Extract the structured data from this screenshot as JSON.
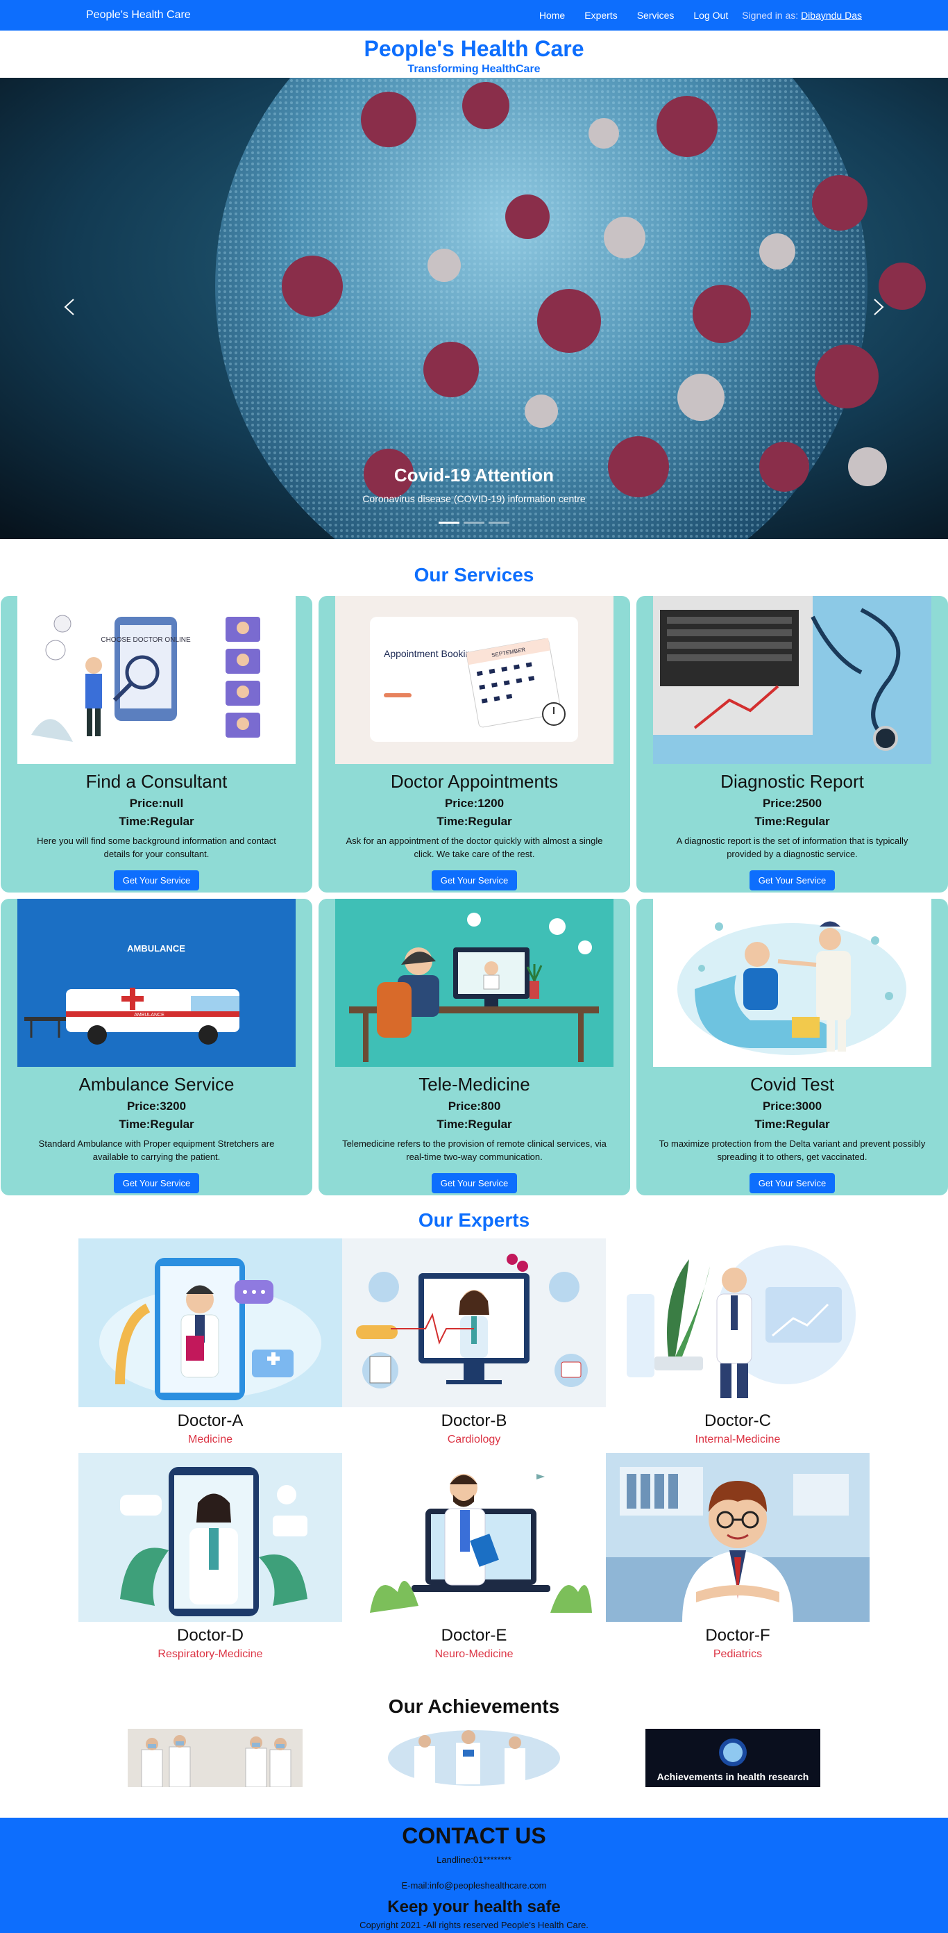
{
  "nav": {
    "brand": "People's Health Care",
    "links": [
      "Home",
      "Experts",
      "Services",
      "Log Out"
    ],
    "signed_in_label": "Signed in as:",
    "user": "Dibayndu Das"
  },
  "header": {
    "title": "People's Health Care",
    "subtitle": "Transforming HealthCare"
  },
  "carousel": {
    "caption_title": "Covid-19 Attention",
    "caption_text": "Coronavirus disease (COVID-19) information centre",
    "slides": 3,
    "active_slide": 1
  },
  "services": {
    "title": "Our Services",
    "button_label": "Get Your Service",
    "items": [
      {
        "name": "Find a Consultant",
        "price": "Price:null",
        "time": "Time:Regular",
        "desc": "Here you will find some background information and contact details for your consultant."
      },
      {
        "name": "Doctor Appointments",
        "price": "Price:1200",
        "time": "Time:Regular",
        "desc": "Ask for an appointment of the doctor quickly with almost a single click. We take care of the rest."
      },
      {
        "name": "Diagnostic Report",
        "price": "Price:2500",
        "time": "Time:Regular",
        "desc": "A diagnostic report is the set of information that is typically provided by a diagnostic service."
      },
      {
        "name": "Ambulance Service",
        "price": "Price:3200",
        "time": "Time:Regular",
        "desc": "Standard Ambulance with Proper equipment Stretchers are available to carrying the patient."
      },
      {
        "name": "Tele-Medicine",
        "price": "Price:800",
        "time": "Time:Regular",
        "desc": "Telemedicine refers to the provision of remote clinical services, via real-time two-way communication."
      },
      {
        "name": "Covid Test",
        "price": "Price:3000",
        "time": "Time:Regular",
        "desc": "To maximize protection from the Delta variant and prevent possibly spreading it to others, get vaccinated."
      }
    ],
    "image_text": {
      "consultant": "CHOOSE DOCTOR ONLINE",
      "appointment": "Appointment Booking",
      "calendar_month": "SEPTEMBER",
      "ambulance_sign": "AMBULANCE",
      "ambulance_body": "AMBULANCE"
    }
  },
  "experts": {
    "title": "Our Experts",
    "items": [
      {
        "name": "Doctor-A",
        "spec": "Medicine"
      },
      {
        "name": "Doctor-B",
        "spec": "Cardiology"
      },
      {
        "name": "Doctor-C",
        "spec": "Internal-Medicine"
      },
      {
        "name": "Doctor-D",
        "spec": "Respiratory-Medicine"
      },
      {
        "name": "Doctor-E",
        "spec": "Neuro-Medicine"
      },
      {
        "name": "Doctor-F",
        "spec": "Pediatrics"
      }
    ]
  },
  "achievements": {
    "title": "Our Achievements",
    "badge_text": "Achievements in health research"
  },
  "footer": {
    "title": "CONTACT US",
    "landline": "Landline:01********",
    "email": "E-mail:info@peopleshealthcare.com",
    "tagline": "Keep your health safe",
    "copyright": "Copyright 2021 -All rights reserved People's Health Care."
  },
  "colors": {
    "primary": "#0d6efd",
    "card_bg": "#8fdbd5",
    "specialty": "#dc3545"
  }
}
